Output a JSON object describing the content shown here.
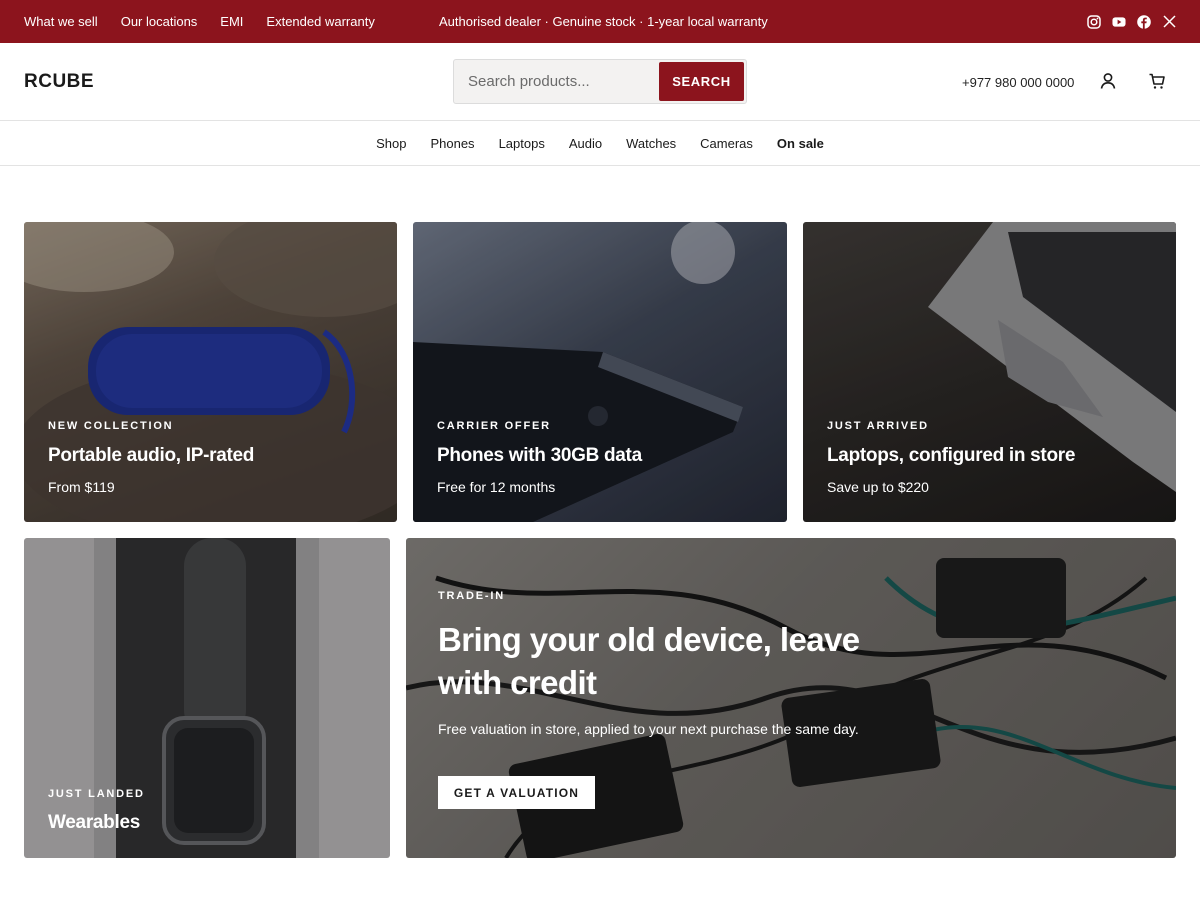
{
  "topbar": {
    "links": [
      "What we sell",
      "Our locations",
      "EMI",
      "Extended warranty"
    ],
    "promo": "Authorised dealer · Genuine stock · 1-year local warranty",
    "social_icons": [
      "instagram-icon",
      "youtube-icon",
      "facebook-icon",
      "x-icon"
    ],
    "background": "#8c141d"
  },
  "header": {
    "logo": "RCUBE",
    "search": {
      "placeholder": "Search products...",
      "button": "SEARCH"
    },
    "phone": "+977 980 000 0000",
    "icons": [
      "account-icon",
      "cart-icon"
    ]
  },
  "nav": {
    "items": [
      "Shop",
      "Phones",
      "Laptops",
      "Audio",
      "Watches",
      "Cameras",
      "On sale"
    ]
  },
  "cards": [
    {
      "eyebrow": "NEW COLLECTION",
      "title": "Portable audio, IP-rated",
      "sub": "From $119"
    },
    {
      "eyebrow": "CARRIER OFFER",
      "title": "Phones with 30GB data",
      "sub": "Free for 12 months"
    },
    {
      "eyebrow": "JUST ARRIVED",
      "title": "Laptops, configured in store",
      "sub": "Save up to $220"
    },
    {
      "eyebrow": "JUST LANDED",
      "title": "Wearables"
    }
  ],
  "tradein": {
    "eyebrow": "TRADE-IN",
    "title": "Bring your old device, leave with credit",
    "sub": "Free valuation in store, applied to your next purchase the same day.",
    "cta": "GET A VALUATION"
  },
  "colors": {
    "accent": "#8c141d",
    "text": "#1a1a1a"
  }
}
